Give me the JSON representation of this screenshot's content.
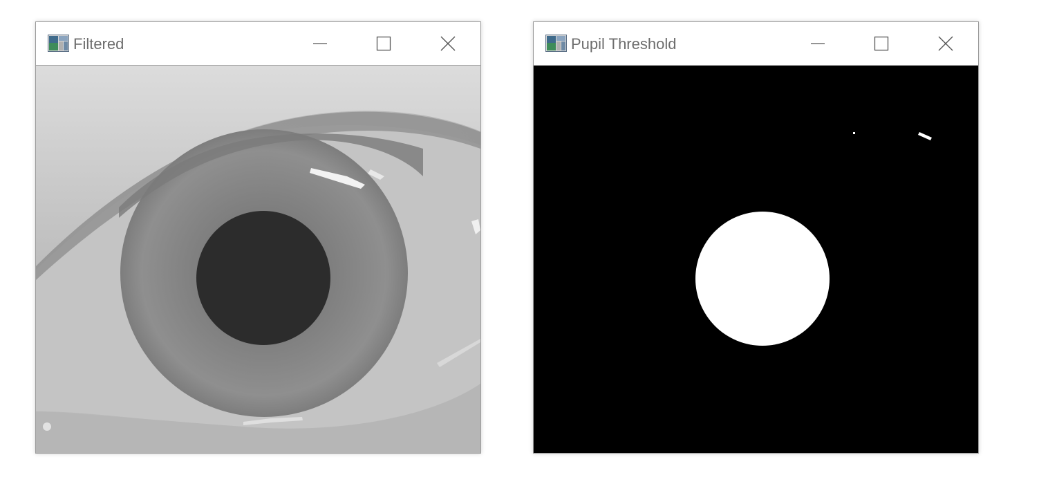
{
  "windows": {
    "filtered": {
      "title": "Filtered",
      "content": "grayscale eye image"
    },
    "threshold": {
      "title": "Pupil Threshold",
      "content": "binary threshold mask"
    }
  },
  "icons": {
    "app": "opencv-window-icon",
    "minimize": "minimize-icon",
    "maximize": "maximize-icon",
    "close": "close-icon"
  },
  "colors": {
    "titlebar_bg": "#ffffff",
    "title_text": "#6d6d6d",
    "threshold_bg": "#000000",
    "threshold_fg": "#ffffff",
    "pupil": "#2c2c2c",
    "iris": "#8a8a8a",
    "sclera": "#c9c9c9"
  }
}
